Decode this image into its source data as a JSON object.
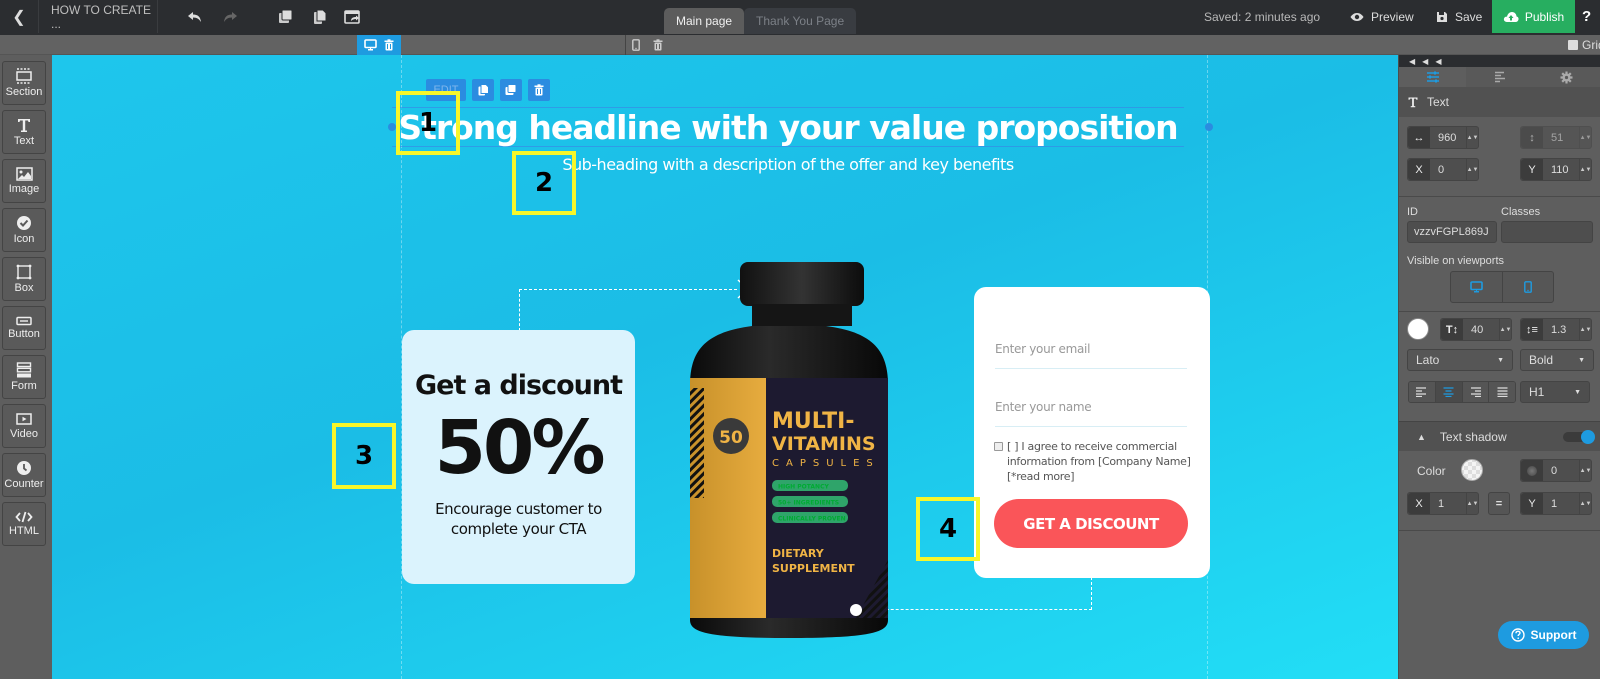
{
  "topbar": {
    "title": "HOW TO CREATE ...",
    "tabs": [
      {
        "label": "Main page",
        "active": true
      },
      {
        "label": "Thank You Page",
        "active": false
      }
    ],
    "saved_status": "Saved: 2 minutes ago",
    "preview_label": "Preview",
    "save_label": "Save",
    "publish_label": "Publish",
    "help_label": "?",
    "grid_label": "Grid"
  },
  "tools": [
    {
      "label": "Section",
      "icon": "section-icon"
    },
    {
      "label": "Text",
      "icon": "text-icon"
    },
    {
      "label": "Image",
      "icon": "image-icon"
    },
    {
      "label": "Icon",
      "icon": "check-circle-icon"
    },
    {
      "label": "Box",
      "icon": "box-icon"
    },
    {
      "label": "Button",
      "icon": "button-icon"
    },
    {
      "label": "Form",
      "icon": "form-icon"
    },
    {
      "label": "Video",
      "icon": "video-icon"
    },
    {
      "label": "Counter",
      "icon": "clock-icon"
    },
    {
      "label": "HTML",
      "icon": "code-icon"
    }
  ],
  "canvas": {
    "edit_label": "EDIT",
    "headline": "Strong headline with your value proposition",
    "subheading": "Sub-heading with a description of the offer and key benefits",
    "discount_card": {
      "title": "Get a discount",
      "value": "50%",
      "description": "Encourage customer to complete your CTA"
    },
    "form": {
      "email_placeholder": "Enter your email",
      "name_placeholder": "Enter your name",
      "consent": "[ ] I agree to receive commercial information from [Company Name] [*read more]",
      "cta_label": "GET A DISCOUNT"
    },
    "product": {
      "badge": "50",
      "name_line1": "MULTI-",
      "name_line2": "VITAMINS",
      "subtitle": "CAPSULES",
      "tags": [
        "HIGH POTANCY",
        "50+ INGREDIENTS",
        "CLINICALLY PROVEN"
      ],
      "footer_line1": "DIETARY",
      "footer_line2": "SUPPLEMENT"
    },
    "markers": [
      "1",
      "2",
      "3",
      "4"
    ]
  },
  "properties": {
    "element_type": "Text",
    "width": "960",
    "height": "51",
    "x": "0",
    "y": "110",
    "id_label": "ID",
    "id_value": "vzzvFGPL869J",
    "classes_label": "Classes",
    "classes_value": "",
    "visible_label": "Visible on viewports",
    "font_size": "40",
    "line_height": "1.3",
    "font_family": "Lato",
    "font_weight": "Bold",
    "heading_level": "H1",
    "text_color": "#ffffff",
    "text_shadow": {
      "label": "Text shadow",
      "enabled": true,
      "color_label": "Color",
      "blur": "0",
      "x": "1",
      "y": "1"
    }
  },
  "support_label": "Support",
  "colors": {
    "accent": "#1e9be0",
    "publish": "#27ae60",
    "cta": "#fa5559",
    "marker": "#f7f72a"
  }
}
